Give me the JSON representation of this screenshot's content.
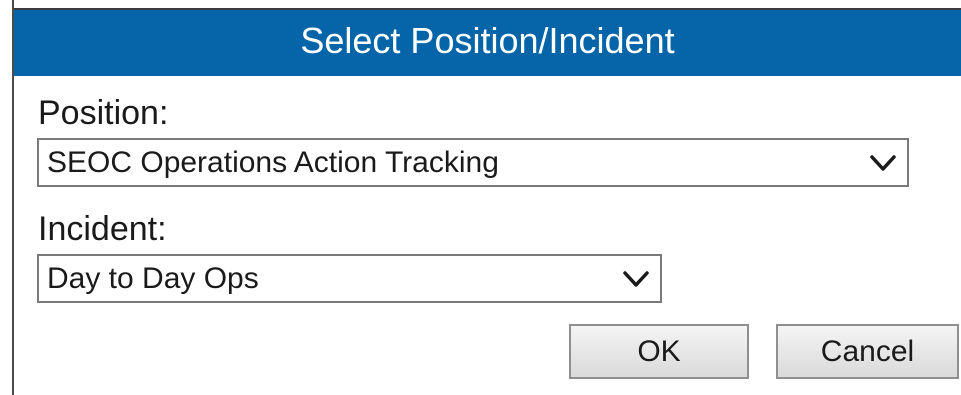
{
  "dialog": {
    "title": "Select Position/Incident"
  },
  "position": {
    "label": "Position:",
    "selected": "SEOC Operations Action Tracking"
  },
  "incident": {
    "label": "Incident:",
    "selected": "Day to Day Ops"
  },
  "buttons": {
    "ok_label": "OK",
    "cancel_label": "Cancel"
  },
  "icons": {
    "dropdown": "chevron-down-icon"
  },
  "colors": {
    "titlebar": "#0565a8",
    "title_text": "#ffffff"
  }
}
